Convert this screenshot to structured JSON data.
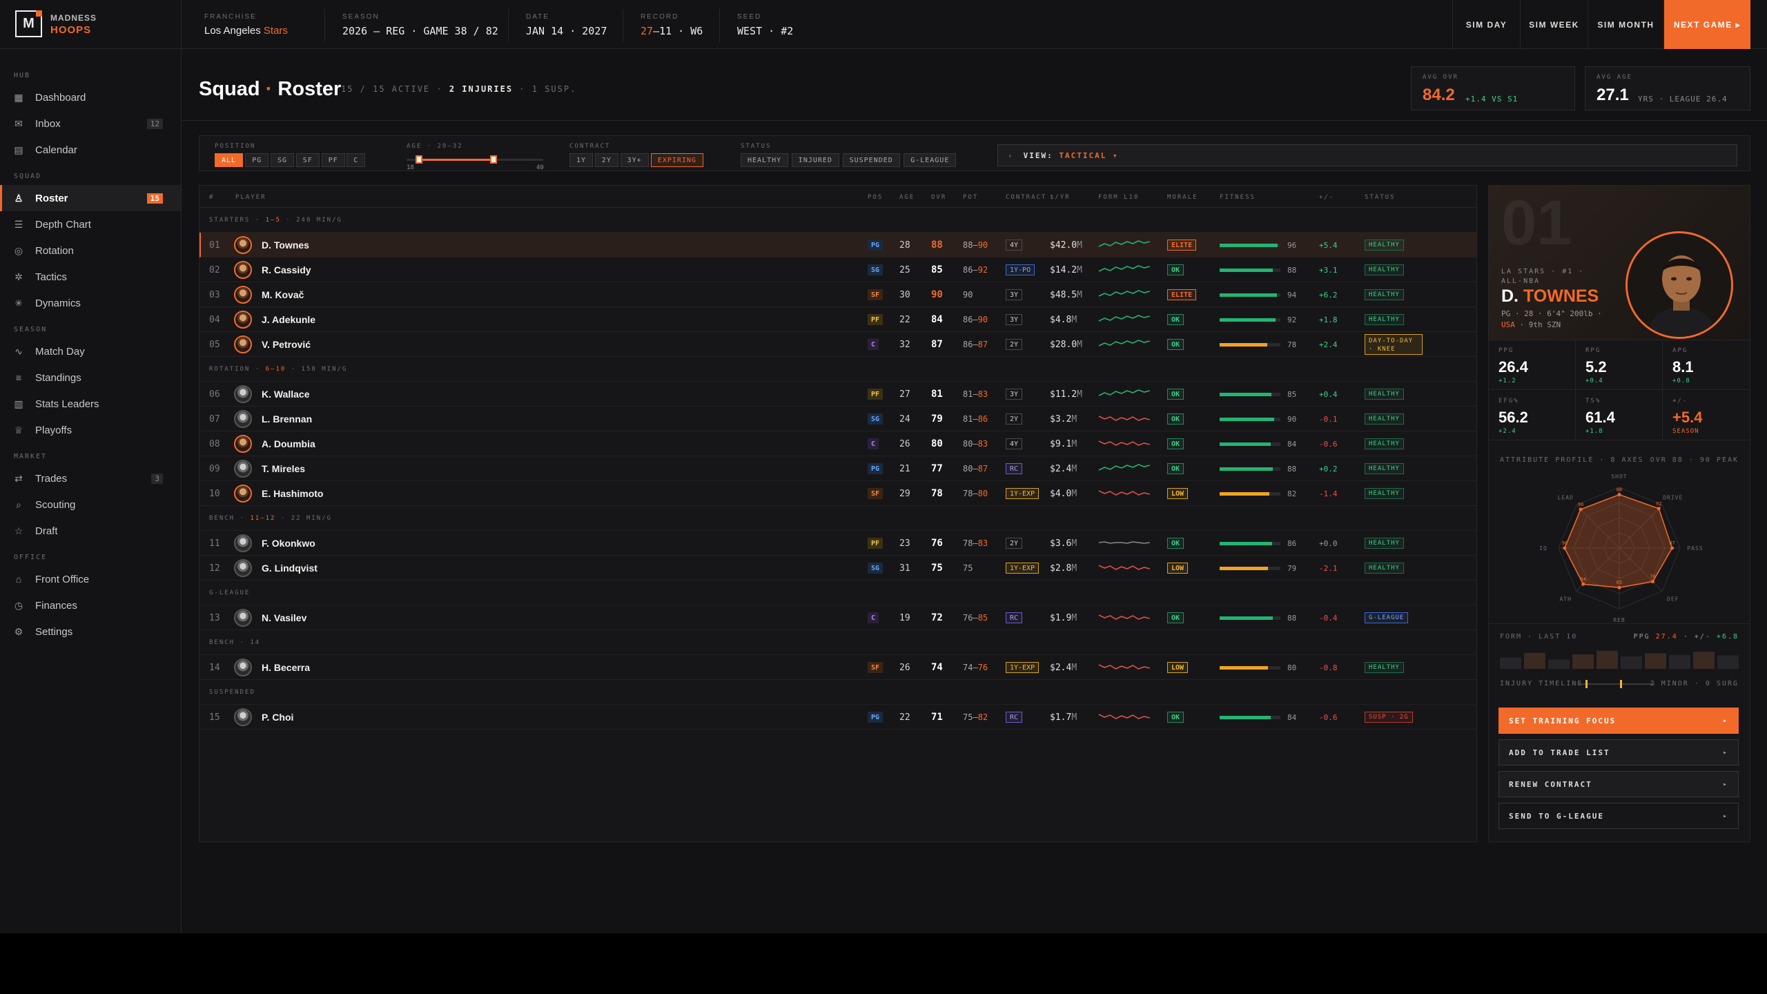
{
  "brand": {
    "line1": "MADNESS",
    "line2": "HOOPS",
    "mark": "M"
  },
  "header": {
    "franchise_label": "FRANCHISE",
    "franchise_city": "Los Angeles",
    "franchise_team": "Stars",
    "season_label": "SEASON",
    "season_value": "2026 — REG · GAME 38 / 82",
    "date_label": "DATE",
    "date_value": "JAN 14 · 2027",
    "record_label": "RECORD",
    "record_w": "27",
    "record_rest": "–11 · W6",
    "seed_label": "SEED",
    "seed_value": "WEST · #2",
    "sim_day": "SIM DAY",
    "sim_week": "SIM WEEK",
    "sim_month": "SIM MONTH",
    "next_game": "NEXT GAME ▸"
  },
  "sidebar": {
    "sections": [
      {
        "label": "HUB",
        "items": [
          {
            "label": "Dashboard",
            "icon": "grid-icon"
          },
          {
            "label": "Inbox",
            "icon": "mail-icon",
            "badge": "12"
          },
          {
            "label": "Calendar",
            "icon": "calendar-icon"
          }
        ]
      },
      {
        "label": "SQUAD",
        "items": [
          {
            "label": "Roster",
            "icon": "user-icon",
            "badge": "15",
            "active": true
          },
          {
            "label": "Depth Chart",
            "icon": "layers-icon"
          },
          {
            "label": "Rotation",
            "icon": "target-icon"
          },
          {
            "label": "Tactics",
            "icon": "sparkle-icon"
          },
          {
            "label": "Dynamics",
            "icon": "asterisk-icon"
          }
        ]
      },
      {
        "label": "SEASON",
        "items": [
          {
            "label": "Match Day",
            "icon": "pulse-icon"
          },
          {
            "label": "Standings",
            "icon": "list-icon"
          },
          {
            "label": "Stats Leaders",
            "icon": "bars-icon"
          },
          {
            "label": "Playoffs",
            "icon": "trophy-icon"
          }
        ]
      },
      {
        "label": "MARKET",
        "items": [
          {
            "label": "Trades",
            "icon": "swap-icon",
            "badge": "3"
          },
          {
            "label": "Scouting",
            "icon": "search-icon"
          },
          {
            "label": "Draft",
            "icon": "star-icon"
          }
        ]
      },
      {
        "label": "OFFICE",
        "items": [
          {
            "label": "Front Office",
            "icon": "building-icon"
          },
          {
            "label": "Finances",
            "icon": "clock-icon"
          },
          {
            "label": "Settings",
            "icon": "gear-icon"
          }
        ]
      }
    ]
  },
  "page": {
    "title_a": "Squad",
    "title_dot": "·",
    "title_b": "Roster",
    "sub_a": "15 / 15 ACTIVE ·",
    "sub_b": "2 INJURIES",
    "sub_c": "· 1 SUSP.",
    "avg_ovr_label": "AVG OVR",
    "avg_ovr": "84.2",
    "avg_ovr_delta": "+1.4 VS S1",
    "avg_age_label": "AVG AGE",
    "avg_age": "27.1",
    "avg_age_note": "YRS · LEAGUE 26.4"
  },
  "filters": {
    "position_label": "POSITION",
    "positions": [
      "ALL",
      "PG",
      "SG",
      "SF",
      "PF",
      "C"
    ],
    "age_label": "AGE · 20–32",
    "age_min": "18",
    "age_max": "40",
    "age_range": [
      20,
      32
    ],
    "age_bounds": [
      18,
      40
    ],
    "contract_label": "CONTRACT",
    "contracts": [
      "1Y",
      "2Y",
      "3Y+",
      "EXPIRING"
    ],
    "status_label": "STATUS",
    "statuses": [
      "HEALTHY",
      "INJURED",
      "SUSPENDED",
      "G-LEAGUE"
    ],
    "view_prefix": "VIEW:",
    "view_value": "TACTICAL ▾"
  },
  "table": {
    "columns": [
      "#",
      "PLAYER",
      "POS",
      "AGE",
      "OVR",
      "POT",
      "CONTRACT",
      "$/YR",
      "FORM L10",
      "MORALE",
      "FITNESS",
      "+/-",
      "STATUS"
    ],
    "groups": [
      {
        "label": "STARTERS ·",
        "hot": "1–5",
        "rest": "· 240 MIN/G"
      },
      {
        "label": "ROTATION ·",
        "hot": "6–10",
        "rest": "· 158 MIN/G"
      },
      {
        "label": "BENCH ·",
        "hot": "11–12",
        "rest": "· 22 MIN/G"
      },
      {
        "label": "G-LEAGUE",
        "hot": "",
        "rest": ""
      },
      {
        "label": "BENCH · 14",
        "hot": "",
        "rest": ""
      },
      {
        "label": "SUSPENDED",
        "hot": "",
        "rest": ""
      }
    ],
    "rows": [
      {
        "n": "01",
        "name": "D. Townes",
        "pos": "PG",
        "age": "28",
        "ovr": "88",
        "ovr_hot": true,
        "pot_a": "88–",
        "pot_b": "90",
        "contract": "4Y",
        "ct": "",
        "sal": "$42.0",
        "unit": "M",
        "form": "up",
        "morale": "ELITE",
        "fit": 96,
        "pm": "+5.4",
        "status": "HEALTHY",
        "st": "HEALTHY",
        "star": true
      },
      {
        "n": "02",
        "name": "R. Cassidy",
        "pos": "SG",
        "age": "25",
        "ovr": "85",
        "pot_a": "86–",
        "pot_b": "92",
        "contract": "1Y-PO",
        "ct": "po",
        "sal": "$14.2",
        "unit": "M",
        "form": "up",
        "morale": "OK",
        "fit": 88,
        "pm": "+3.1",
        "status": "HEALTHY",
        "st": "HEALTHY",
        "star": true
      },
      {
        "n": "03",
        "name": "M. Kovač",
        "pos": "SF",
        "age": "30",
        "ovr": "90",
        "ovr_hot": true,
        "pot_a": "90",
        "pot_b": "",
        "contract": "3Y",
        "ct": "",
        "sal": "$48.5",
        "unit": "M",
        "form": "up",
        "morale": "ELITE",
        "fit": 94,
        "pm": "+6.2",
        "status": "HEALTHY",
        "st": "HEALTHY",
        "star": true
      },
      {
        "n": "04",
        "name": "J. Adekunle",
        "pos": "PF",
        "age": "22",
        "ovr": "84",
        "pot_a": "86–",
        "pot_b": "90",
        "contract": "3Y",
        "ct": "",
        "sal": "$4.8",
        "unit": "M",
        "form": "up",
        "morale": "OK",
        "fit": 92,
        "pm": "+1.8",
        "status": "HEALTHY",
        "st": "HEALTHY",
        "star": true
      },
      {
        "n": "05",
        "name": "V. Petrović",
        "pos": "C",
        "age": "32",
        "ovr": "87",
        "pot_a": "86–",
        "pot_b": "87",
        "contract": "2Y",
        "ct": "",
        "sal": "$28.0",
        "unit": "M",
        "form": "up",
        "morale": "OK",
        "fit": 78,
        "pm": "+2.4",
        "status": "DAY-TO-DAY · KNEE",
        "st": "DTD",
        "star": true
      },
      {
        "n": "06",
        "name": "K. Wallace",
        "pos": "PF",
        "age": "27",
        "ovr": "81",
        "pot_a": "81–",
        "pot_b": "83",
        "contract": "3Y",
        "ct": "",
        "sal": "$11.2",
        "unit": "M",
        "form": "up",
        "morale": "OK",
        "fit": 85,
        "pm": "+0.4",
        "status": "HEALTHY",
        "st": "HEALTHY"
      },
      {
        "n": "07",
        "name": "L. Brennan",
        "pos": "SG",
        "age": "24",
        "ovr": "79",
        "pot_a": "81–",
        "pot_b": "86",
        "contract": "2Y",
        "ct": "",
        "sal": "$3.2",
        "unit": "M",
        "form": "down",
        "morale": "OK",
        "fit": 90,
        "pm": "-0.1",
        "status": "HEALTHY",
        "st": "HEALTHY"
      },
      {
        "n": "08",
        "name": "A. Doumbia",
        "pos": "C",
        "age": "26",
        "ovr": "80",
        "pot_a": "80–",
        "pot_b": "83",
        "contract": "4Y",
        "ct": "",
        "sal": "$9.1",
        "unit": "M",
        "form": "down",
        "morale": "OK",
        "fit": 84,
        "pm": "-0.6",
        "status": "HEALTHY",
        "st": "HEALTHY",
        "star": true
      },
      {
        "n": "09",
        "name": "T. Mireles",
        "pos": "PG",
        "age": "21",
        "ovr": "77",
        "pot_a": "80–",
        "pot_b": "87",
        "contract": "RC",
        "ct": "rc",
        "sal": "$2.4",
        "unit": "M",
        "form": "up",
        "morale": "OK",
        "fit": 88,
        "pm": "+0.2",
        "status": "HEALTHY",
        "st": "HEALTHY"
      },
      {
        "n": "10",
        "name": "E. Hashimoto",
        "pos": "SF",
        "age": "29",
        "ovr": "78",
        "pot_a": "78–",
        "pot_b": "80",
        "contract": "1Y-EXP",
        "ct": "exp",
        "sal": "$4.0",
        "unit": "M",
        "form": "down",
        "morale": "LOW",
        "fit": 82,
        "pm": "-1.4",
        "status": "HEALTHY",
        "st": "HEALTHY",
        "star": true
      },
      {
        "n": "11",
        "name": "F. Okonkwo",
        "pos": "PF",
        "age": "23",
        "ovr": "76",
        "pot_a": "78–",
        "pot_b": "83",
        "contract": "2Y",
        "ct": "",
        "sal": "$3.6",
        "unit": "M",
        "form": "flat",
        "morale": "OK",
        "fit": 86,
        "pm": "+0.0",
        "status": "HEALTHY",
        "st": "HEALTHY"
      },
      {
        "n": "12",
        "name": "G. Lindqvist",
        "pos": "SG",
        "age": "31",
        "ovr": "75",
        "pot_a": "75",
        "pot_b": "",
        "contract": "1Y-EXP",
        "ct": "exp",
        "sal": "$2.8",
        "unit": "M",
        "form": "down",
        "morale": "LOW",
        "fit": 79,
        "pm": "-2.1",
        "status": "HEALTHY",
        "st": "HEALTHY"
      },
      {
        "n": "13",
        "name": "N. Vasilev",
        "pos": "C",
        "age": "19",
        "ovr": "72",
        "pot_a": "76–",
        "pot_b": "85",
        "contract": "RC",
        "ct": "rc",
        "sal": "$1.9",
        "unit": "M",
        "form": "down",
        "morale": "OK",
        "fit": 88,
        "pm": "-0.4",
        "status": "G-LEAGUE",
        "st": "GL"
      },
      {
        "n": "14",
        "name": "H. Becerra",
        "pos": "SF",
        "age": "26",
        "ovr": "74",
        "pot_a": "74–",
        "pot_b": "76",
        "contract": "1Y-EXP",
        "ct": "exp",
        "sal": "$2.4",
        "unit": "M",
        "form": "down",
        "morale": "LOW",
        "fit": 80,
        "pm": "-0.8",
        "status": "HEALTHY",
        "st": "HEALTHY"
      },
      {
        "n": "15",
        "name": "P. Choi",
        "pos": "PG",
        "age": "22",
        "ovr": "71",
        "pot_a": "75–",
        "pot_b": "82",
        "contract": "RC",
        "ct": "rc",
        "sal": "$1.7",
        "unit": "M",
        "form": "down",
        "morale": "OK",
        "fit": 84,
        "pm": "-0.6",
        "status": "SUSP · 2G",
        "st": "SUSP"
      }
    ]
  },
  "panel": {
    "number": "01",
    "sub": "LA STARS · #1 · ALL-NBA",
    "first": "D.",
    "last": "TOWNES",
    "info_a": "PG · 28 · 6'4\" 200lb ·",
    "info_country": "USA",
    "info_b": "· 9th SZN",
    "stats": [
      {
        "l": "PPG",
        "v": "26.4",
        "d": "+1.2"
      },
      {
        "l": "RPG",
        "v": "5.2",
        "d": "+0.4"
      },
      {
        "l": "APG",
        "v": "8.1",
        "d": "+0.8"
      },
      {
        "l": "EFG%",
        "v": "56.2",
        "d": "+2.4"
      },
      {
        "l": "TS%",
        "v": "61.4",
        "d": "+1.8"
      },
      {
        "l": "+/-",
        "v": "+5.4",
        "d": "SEASON"
      }
    ],
    "attr_label": "ATTRIBUTE PROFILE · 8 AXES",
    "attr_right": "OVR 88 · 90 PEAK",
    "radar_axes": [
      "SHOT",
      "DRIVE",
      "PASS",
      "DEF",
      "REB",
      "ATH",
      "IQ",
      "LEAD"
    ],
    "radar_values": [
      88,
      92,
      87,
      78,
      65,
      84,
      90,
      90
    ],
    "form_label": "FORM · LAST 10",
    "form_ppg_lab": "PPG",
    "form_ppg": "27.4",
    "form_pm_lab": "· +/-",
    "form_pm": "+6.8",
    "form_bars": [
      22,
      31,
      18,
      28,
      35,
      24,
      30,
      27,
      33,
      26
    ],
    "injury_label": "INJURY TIMELINE",
    "injury_note": "2 MINOR · 0 SURG",
    "actions": [
      "SET TRAINING FOCUS",
      "ADD TO TRADE LIST",
      "RENEW CONTRACT",
      "SEND TO G-LEAGUE"
    ]
  }
}
